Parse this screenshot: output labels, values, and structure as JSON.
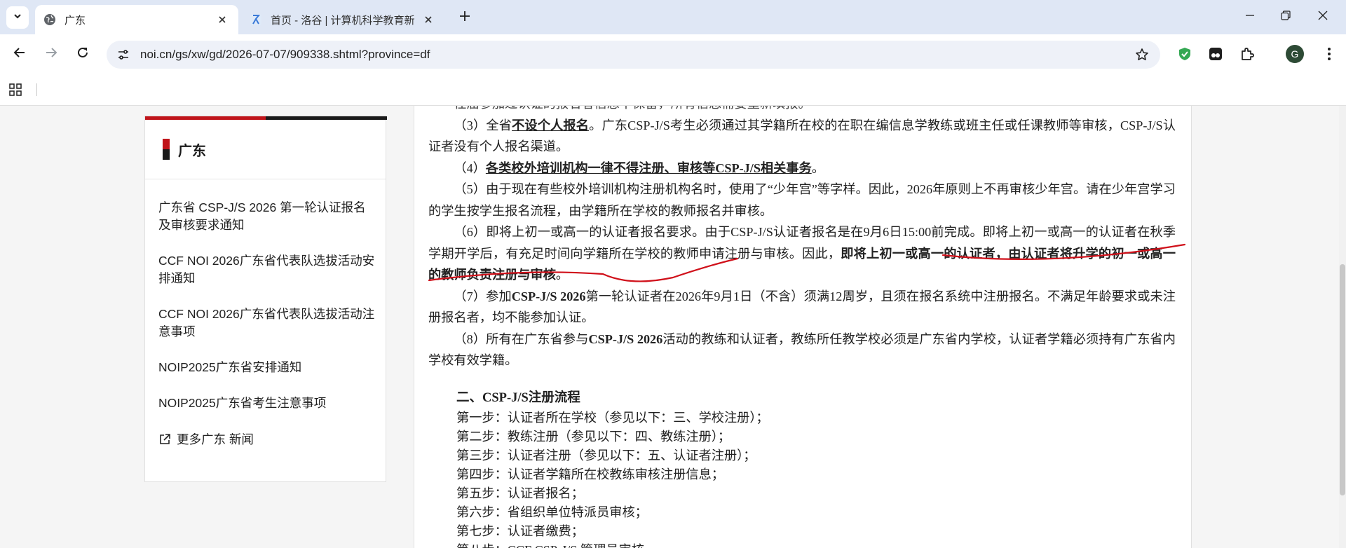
{
  "browser": {
    "tabs": [
      {
        "title": "广东",
        "active": true
      },
      {
        "title": "首页 - 洛谷 | 计算机科学教育新",
        "active": false
      }
    ],
    "url": "noi.cn/gs/xw/gd/2026-07-07/909338.shtml?province=df",
    "profile_initial": "G"
  },
  "sidebar": {
    "title": "广东",
    "items": [
      "广东省 CSP-J/S 2026 第一轮认证报名及审核要求通知",
      "CCF NOI 2026广东省代表队选拔活动安排通知",
      "CCF NOI 2026广东省代表队选拔活动注意事项",
      "NOIP2025广东省安排通知",
      "NOIP2025广东省考生注意事项"
    ],
    "more": "更多广东 新闻"
  },
  "article": {
    "p0": "任届参加过认证的报名者信息不保留，所有信息需要重新填报。",
    "p3_a": "（3）全省",
    "p3_u": "不设个人报名",
    "p3_b": "。广东CSP-J/S考生必须通过其学籍所在校的在职在编信息学教练或班主任或任课教师等审核，CSP-J/S认证者没有个人报名渠道。",
    "p4_a": "（4）",
    "p4_u": "各类校外培训机构一律不得注册、审核等CSP-J/S相关事务",
    "p4_b": "。",
    "p5": "（5）由于现在有些校外培训机构注册机构名时，使用了“少年宫”等字样。因此，2026年原则上不再审核少年宫。请在少年宫学习的学生按学生报名流程，由学籍所在学校的教师报名并审核。",
    "p6_a": "（6）即将上初一或高一的认证者报名要求。由于CSP-J/S认证者报名是在9月6日15:00前完成。即将上初一或高一的认证者在秋季学期开学后，有充足时间向学籍所在学校的教师申请注册与审核。因此，",
    "p6_b": "即将上初一或高一的认证者，由认证者将升学的初一或高一的教师负责注册与审核",
    "p6_c": "。",
    "p7_a": "（7）参加",
    "p7_b": "CSP-J/S 2026",
    "p7_c": "第一轮认证者在2026年9月1日（不含）须满12周岁，且须在报名系统中注册报名。不满足年龄要求或未注册报名者，均不能参加认证。",
    "p8_a": "（8）所有在广东省参与",
    "p8_b": "CSP-J/S 2026",
    "p8_c": "活动的教练和认证者，教练所任教学校必须是广东省内学校，认证者学籍必须持有广东省内学校有效学籍。",
    "section2_title": "二、CSP-J/S注册流程",
    "steps": [
      "第一步：认证者所在学校（参见以下：三、学校注册）；",
      "第二步：教练注册（参见以下：四、教练注册）；",
      "第三步：认证者注册（参见以下：五、认证者注册）；",
      "第四步：认证者学籍所在校教练审核注册信息；",
      "第五步：认证者报名；",
      "第六步：省组织单位特派员审核；",
      "第七步：认证者缴费；",
      "第八步：CCF CSP-J/S 管理员审核"
    ]
  },
  "colors": {
    "accent_red": "#c0141a",
    "annotation_red": "#d0101a"
  }
}
